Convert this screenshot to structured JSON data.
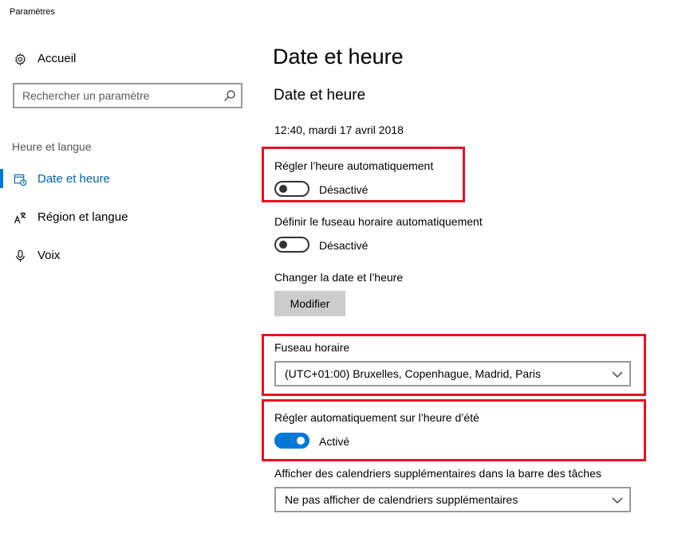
{
  "window": {
    "title": "Paramètres"
  },
  "sidebar": {
    "home_label": "Accueil",
    "search": {
      "placeholder": "Rechercher un paramètre"
    },
    "section_label": "Heure et langue",
    "items": [
      {
        "label": "Date et heure",
        "icon": "calendar-clock-icon",
        "selected": true
      },
      {
        "label": "Région et langue",
        "icon": "language-icon",
        "selected": false
      },
      {
        "label": "Voix",
        "icon": "microphone-icon",
        "selected": false
      }
    ]
  },
  "main": {
    "page_title": "Date et heure",
    "section_title": "Date et heure",
    "current_datetime": "12:40, mardi 17 avril 2018",
    "auto_time": {
      "label": "Régler l’heure automatiquement",
      "state": "Désactivé",
      "on": false
    },
    "auto_timezone": {
      "label": "Définir le fuseau horaire automatiquement",
      "state": "Désactivé",
      "on": false
    },
    "change_date": {
      "label": "Changer la date et l’heure",
      "button": "Modifier"
    },
    "timezone": {
      "label": "Fuseau horaire",
      "value": "(UTC+01:00) Bruxelles, Copenhague, Madrid, Paris"
    },
    "dst": {
      "label": "Régler automatiquement sur l’heure d’été",
      "state": "Activé",
      "on": true
    },
    "calendars": {
      "label": "Afficher des calendriers supplémentaires dans la barre des tâches",
      "value": "Ne pas afficher de calendriers supplémentaires"
    }
  },
  "colors": {
    "accent": "#0078d7",
    "highlight": "#e81123",
    "selected_text": "#0063b1"
  }
}
